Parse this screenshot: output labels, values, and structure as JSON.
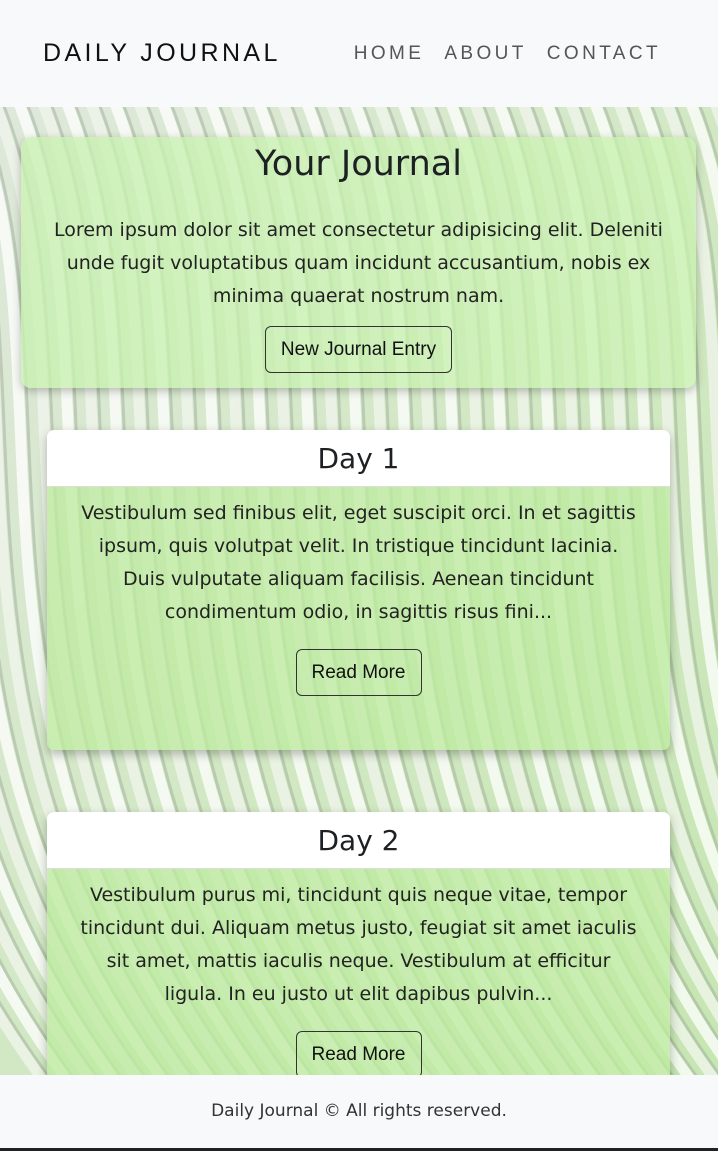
{
  "header": {
    "brand": "DAILY JOURNAL",
    "nav": [
      "HOME",
      "ABOUT",
      "CONTACT"
    ]
  },
  "hero": {
    "title": "Your Journal",
    "text": "Lorem ipsum dolor sit amet consectetur adipisicing elit. Deleniti unde fugit voluptatibus quam incidunt accusantium, nobis ex minima quaerat nostrum nam.",
    "button": "New Journal Entry"
  },
  "entries": [
    {
      "title": "Day 1",
      "excerpt": "Vestibulum sed finibus elit, eget suscipit orci. In et sagittis ipsum, quis volutpat velit. In tristique tincidunt lacinia. Duis vulputate aliquam facilisis. Aenean tincidunt condimentum odio, in sagittis risus fini...",
      "button": "Read More"
    },
    {
      "title": "Day 2",
      "excerpt": "Vestibulum purus mi, tincidunt quis neque vitae, tempor tincidunt dui. Aliquam metus justo, feugiat sit amet iaculis sit amet, mattis iaculis neque. Vestibulum at efficitur ligula. In eu justo ut elit dapibus pulvin...",
      "button": "Read More"
    }
  ],
  "footer": {
    "text": "Daily Journal © All rights reserved."
  },
  "colors": {
    "card_tint": "#c8f0af",
    "header_bg": "#f8f9fa",
    "footer_bg": "#f8f9fa"
  }
}
